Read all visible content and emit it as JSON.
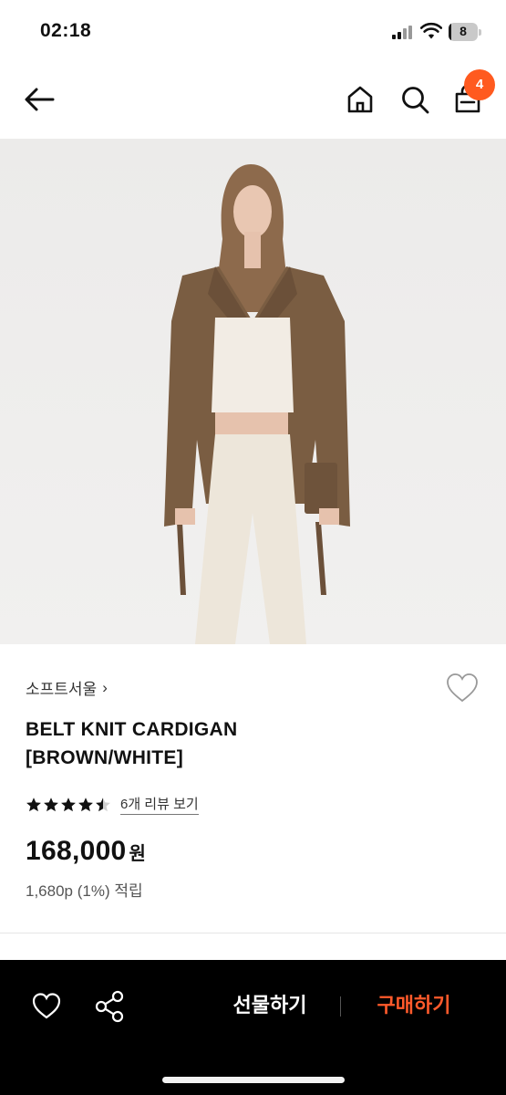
{
  "status_bar": {
    "time": "02:18",
    "battery_level": "8",
    "icons": [
      "signal-icon",
      "wifi-icon",
      "battery-icon"
    ]
  },
  "nav": {
    "icons": [
      "back-arrow-icon",
      "home-icon",
      "search-icon",
      "cart-icon"
    ],
    "cart_count": "4",
    "accent_color": "#ff5a1f"
  },
  "product": {
    "brand": "소프트서울",
    "brand_chevron": "›",
    "title_line1": "BELT KNIT CARDIGAN",
    "title_line2": "[BROWN/WHITE]",
    "rating": 4.5,
    "rating_max": 5,
    "review_link": "6개 리뷰 보기",
    "price": "168,000",
    "currency": "원",
    "points": "1,680p (1%) 적립"
  },
  "bottom_bar": {
    "gift_label": "선물하기",
    "buy_label": "구매하기",
    "buy_color": "#ff5a2b",
    "icons": [
      "heart-outline-icon",
      "share-icon"
    ]
  }
}
